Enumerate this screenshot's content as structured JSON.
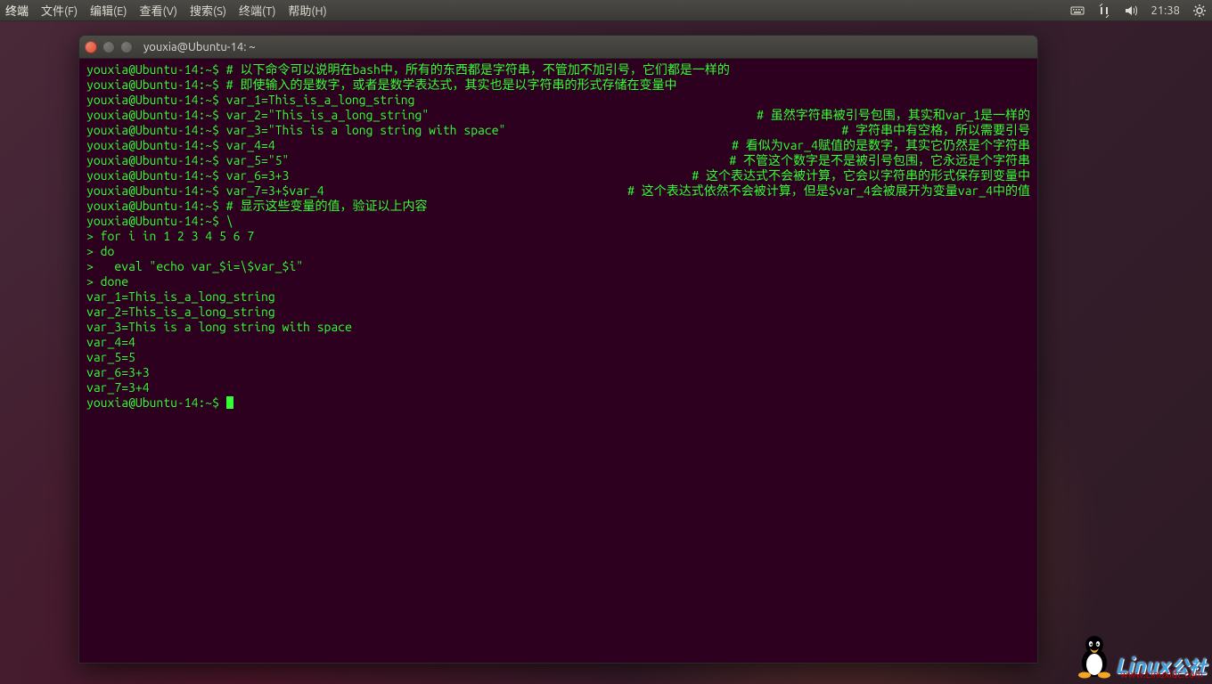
{
  "menubar": {
    "app": "终端",
    "items": [
      "文件(F)",
      "编辑(E)",
      "查看(V)",
      "搜索(S)",
      "终端(T)",
      "帮助(H)"
    ],
    "time": "21:38"
  },
  "window": {
    "title": "youxia@Ubuntu-14: ~"
  },
  "prompt": "youxia@Ubuntu-14:~$ ",
  "lines": [
    {
      "l": "# 以下命令可以说明在bash中，所有的东西都是字符串，不管加不加引号，它们都是一样的",
      "r": ""
    },
    {
      "l": "# 即使输入的是数字，或者是数学表达式，其实也是以字符串的形式存储在变量中",
      "r": ""
    },
    {
      "l": "var_1=This_is_a_long_string",
      "r": ""
    },
    {
      "l": "var_2=\"This_is_a_long_string\"",
      "r": "# 虽然字符串被引号包围，其实和var_1是一样的"
    },
    {
      "l": "var_3=\"This is a long string with space\"",
      "r": "# 字符串中有空格，所以需要引号"
    },
    {
      "l": "var_4=4",
      "r": "# 看似为var_4赋值的是数字，其实它仍然是个字符串"
    },
    {
      "l": "var_5=\"5\"",
      "r": "# 不管这个数字是不是被引号包围，它永远是个字符串"
    },
    {
      "l": "var_6=3+3",
      "r": "# 这个表达式不会被计算，它会以字符串的形式保存到变量中"
    },
    {
      "l": "var_7=3+$var_4",
      "r": "# 这个表达式依然不会被计算，但是$var_4会被展开为变量var_4中的值"
    },
    {
      "l": "# 显示这些变量的值，验证以上内容",
      "r": ""
    },
    {
      "l": "\\",
      "r": ""
    }
  ],
  "cont": [
    "> for i in 1 2 3 4 5 6 7",
    "> do",
    ">   eval \"echo var_$i=\\$var_$i\"",
    "> done"
  ],
  "output": [
    "var_1=This_is_a_long_string",
    "var_2=This_is_a_long_string",
    "var_3=This is a long string with space",
    "var_4=4",
    "var_5=5",
    "var_6=3+3",
    "var_7=3+4"
  ],
  "watermark": {
    "text": "Linux",
    "suffix": "公社",
    "url": "www.Linuxidc.com"
  }
}
